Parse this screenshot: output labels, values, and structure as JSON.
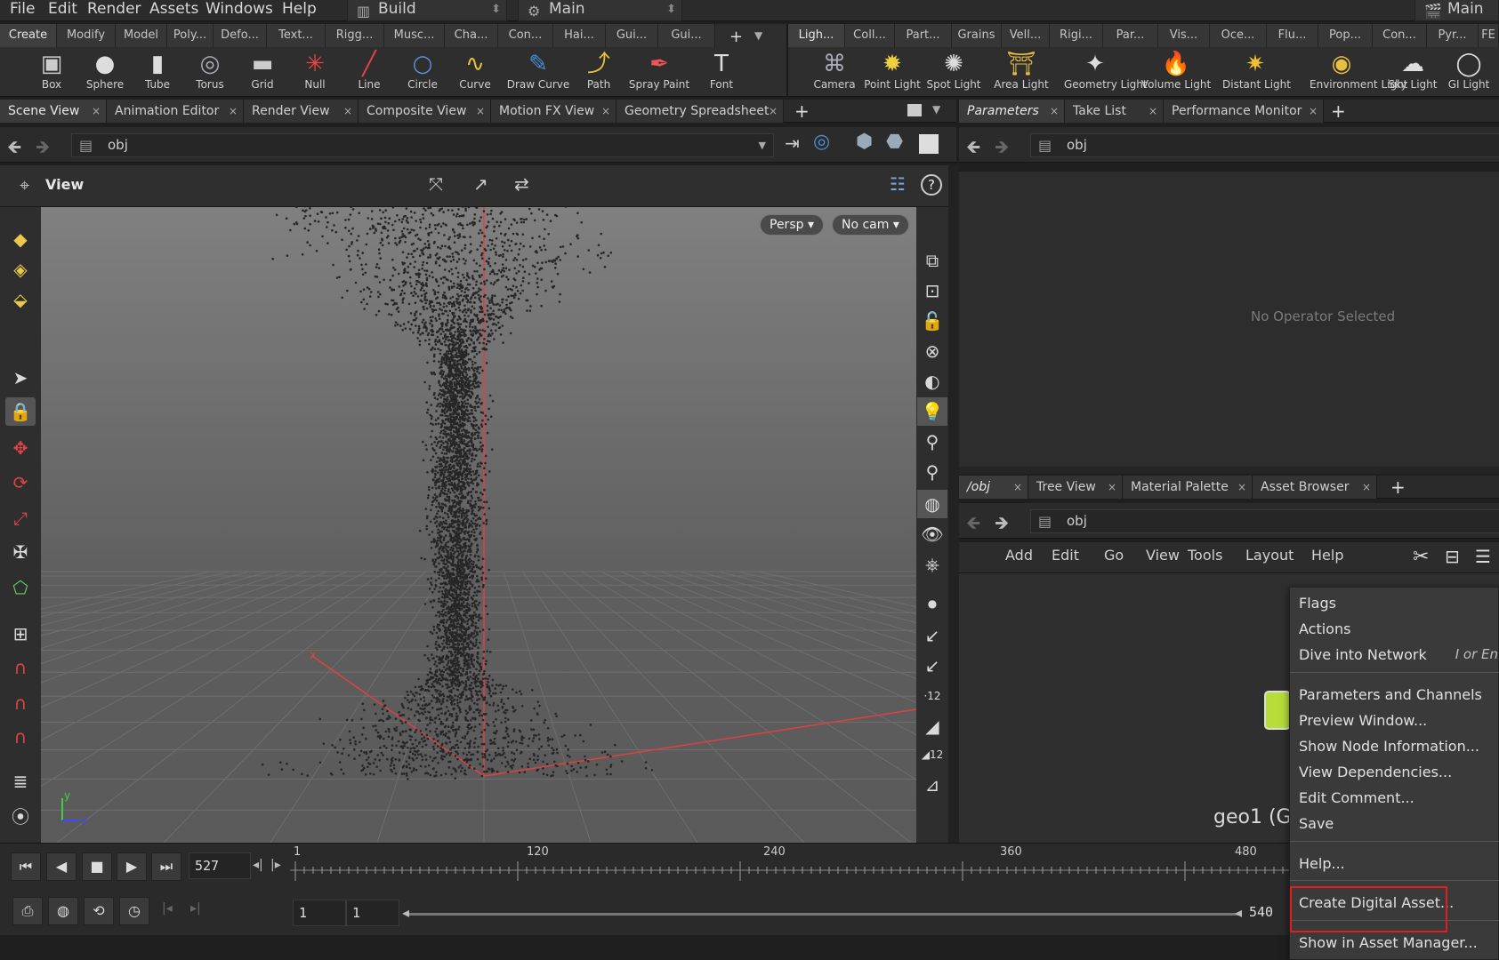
{
  "menubar": {
    "items": [
      "File",
      "Edit",
      "Render",
      "Assets",
      "Windows",
      "Help"
    ],
    "desktop": "Build",
    "context": "Main",
    "right_label": "Main"
  },
  "shelf": {
    "left_tabs": [
      "Create",
      "Modify",
      "Model",
      "Poly...",
      "Defo...",
      "Text...",
      "Rigg...",
      "Musc...",
      "Cha...",
      "Con...",
      "Hai...",
      "Gui...",
      "Gui..."
    ],
    "right_tabs": [
      "Ligh...",
      "Coll...",
      "Part...",
      "Grains",
      "Vell...",
      "Rigi...",
      "Par...",
      "Vis...",
      "Oce...",
      "Flu...",
      "Pop...",
      "Con...",
      "Pyr...",
      "FE"
    ],
    "left_tools": [
      {
        "label": "Box",
        "icon": "box-icon",
        "glyph": "▣"
      },
      {
        "label": "Sphere",
        "icon": "sphere-icon",
        "glyph": "●"
      },
      {
        "label": "Tube",
        "icon": "tube-icon",
        "glyph": "▮"
      },
      {
        "label": "Torus",
        "icon": "torus-icon",
        "glyph": "◎"
      },
      {
        "label": "Grid",
        "icon": "grid-icon",
        "glyph": "▬"
      },
      {
        "label": "Null",
        "icon": "null-icon",
        "glyph": "✳"
      },
      {
        "label": "Line",
        "icon": "line-icon",
        "glyph": "╱"
      },
      {
        "label": "Circle",
        "icon": "circle-icon",
        "glyph": "○"
      },
      {
        "label": "Curve",
        "icon": "curve-icon",
        "glyph": "∿"
      },
      {
        "label": "Draw Curve",
        "icon": "draw-curve-icon",
        "glyph": "✎"
      },
      {
        "label": "Path",
        "icon": "path-icon",
        "glyph": "⤴"
      },
      {
        "label": "Spray Paint",
        "icon": "spray-paint-icon",
        "glyph": "✒"
      },
      {
        "label": "Font",
        "icon": "font-icon",
        "glyph": "T"
      }
    ],
    "right_tools": [
      {
        "label": "Camera",
        "icon": "camera-icon",
        "glyph": "⌘"
      },
      {
        "label": "Point Light",
        "icon": "point-light-icon",
        "glyph": "✹"
      },
      {
        "label": "Spot Light",
        "icon": "spot-light-icon",
        "glyph": "✺"
      },
      {
        "label": "Area Light",
        "icon": "area-light-icon",
        "glyph": "⛩"
      },
      {
        "label": "Geometry Light",
        "icon": "geometry-light-icon",
        "glyph": "✦"
      },
      {
        "label": "Volume Light",
        "icon": "volume-light-icon",
        "glyph": "🔥"
      },
      {
        "label": "Distant Light",
        "icon": "distant-light-icon",
        "glyph": "✷"
      },
      {
        "label": "Environment Light",
        "icon": "environment-light-icon",
        "glyph": "◉"
      },
      {
        "label": "Sky Light",
        "icon": "sky-light-icon",
        "glyph": "☁"
      },
      {
        "label": "GI Light",
        "icon": "gi-light-icon",
        "glyph": "◯"
      }
    ]
  },
  "left_pane": {
    "tabs": [
      "Scene View",
      "Animation Editor",
      "Render View",
      "Composite View",
      "Motion FX View",
      "Geometry Spreadsheet"
    ],
    "path": "obj",
    "view_label": "View",
    "persp": "Persp",
    "cam": "No cam",
    "axis_x": "x",
    "axis_y": "y",
    "axis_z": "z"
  },
  "params_pane": {
    "tabs": [
      "Parameters",
      "Take List",
      "Performance Monitor"
    ],
    "path": "obj",
    "empty_message": "No Operator Selected"
  },
  "net_pane": {
    "tabs": [
      "/obj",
      "Tree View",
      "Material Palette",
      "Asset Browser"
    ],
    "path": "obj",
    "menu": [
      "Add",
      "Edit",
      "Go",
      "View",
      "Tools",
      "Layout",
      "Help"
    ],
    "node_label": "geo1 (Ge"
  },
  "context_menu": {
    "items": [
      "Flags",
      "Actions",
      "Dive into Network",
      "Parameters and Channels",
      "Preview Window...",
      "Show Node Information...",
      "View Dependencies...",
      "Edit Comment...",
      "Save",
      "Help...",
      "Create Digital Asset...",
      "Show in Asset Manager..."
    ],
    "dive_shortcut": "I or En"
  },
  "timeline": {
    "current_frame": "527",
    "ticks": [
      "1",
      "120",
      "240",
      "360",
      "480"
    ],
    "range_start": "1",
    "range_start2": "1",
    "range_end": "540"
  }
}
